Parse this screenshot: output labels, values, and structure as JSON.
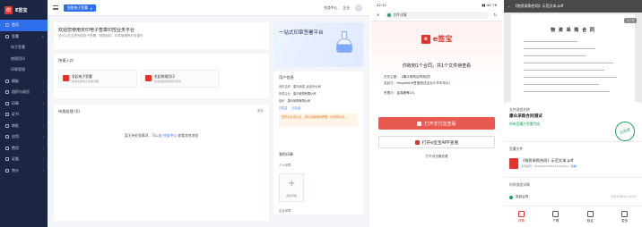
{
  "panel1": {
    "brand": "E签宝",
    "nav": [
      {
        "label": "首页",
        "active": true,
        "arrow": ""
      },
      {
        "label": "签署",
        "active": false,
        "arrow": "∨"
      },
      {
        "label": "电子签署",
        "active": false,
        "sub": true,
        "arrow": ""
      },
      {
        "label": "物理用印",
        "active": false,
        "sub": true,
        "arrow": ""
      },
      {
        "label": "印章管理",
        "active": false,
        "sub": true,
        "arrow": ""
      },
      {
        "label": "模板",
        "active": false,
        "arrow": "›"
      },
      {
        "label": "组织与成员",
        "active": false,
        "arrow": "›"
      },
      {
        "label": "印章",
        "active": false,
        "arrow": "›"
      },
      {
        "label": "证书",
        "active": false,
        "arrow": "›"
      },
      {
        "label": "审批",
        "active": false,
        "arrow": "›"
      },
      {
        "label": "应用",
        "active": false,
        "arrow": "›"
      },
      {
        "label": "费用",
        "active": false,
        "arrow": "›"
      },
      {
        "label": "证据",
        "active": false,
        "arrow": "›"
      },
      {
        "label": "统计",
        "active": false,
        "arrow": "›"
      }
    ],
    "platform_select": "智能电子签署",
    "top_right": {
      "item1": "任务中心",
      "item2": "企业"
    },
    "banner": {
      "text": "欢迎您使用天印电子签章印控业务平台",
      "sub": "您可以在这里完成电子签署、物理用印、印章管理等业务操作"
    },
    "quick": {
      "title": "快速入口",
      "items": [
        {
          "label": "发起电子签署",
          "sub": "快速发起电子签署流程"
        },
        {
          "label": "发起物理用印",
          "sub": "快速发起物理用印申请"
        }
      ]
    },
    "todo": {
      "title": "待我处理",
      "count": "(0)",
      "more": "更多",
      "empty_prefix": "暂无待处理事项，可以去",
      "empty_link": "任务中心",
      "empty_suffix": "查看其他流程"
    },
    "promo": {
      "title": "一站式印章签署平台"
    },
    "user": {
      "title": "用户信息",
      "rows": [
        {
          "k": "我的名称：",
          "v": "康众测试, 北京分公司"
        },
        {
          "k": "所属企业：",
          "v": "康众采购有限公司"
        },
        {
          "k": "组织：",
          "v": "康众采购有限公司"
        }
      ],
      "tags": [
        "已实名",
        "已认证"
      ],
      "warn": "您的企业未认证，部分功能使用受限，请尽快认证。",
      "seal_title": "我的印章",
      "personal_seal": "个人印章",
      "add_seal": "添加印章",
      "org_seal": "企业印章"
    }
  },
  "panel2": {
    "status_time": "22:12",
    "status_icons": "▮▮ 4G 78",
    "url_title": "文件详情",
    "brand": "e签宝",
    "message": "你收到1个合同，共1个文件待查看",
    "info": [
      {
        "k": "任务主题：",
        "v": "《康众采购合同测试》"
      },
      {
        "k": "发起方：",
        "v": "esignest(e签宝测试企业3-华中东片)"
      },
      {
        "k": "签署方：",
        "v": "孟笑峰等2人"
      }
    ],
    "btn_primary": "打开支付宝查看",
    "btn_secondary": "打开e签宝APP查看",
    "browser_link": "打开浏览器查看"
  },
  "panel3": {
    "header_title": "《物资采购合同》示范文本.pdf",
    "page_badge": "1 / 5",
    "doc_title": "物 资 采 购 合 同",
    "sheet": {
      "label_name": "文件流程名称",
      "name": "康众采购合同测试",
      "status": "所有签署方签署完成",
      "stamp": "已完成",
      "label_files": "签署文件",
      "file_name": "《物资采购合同》示范文本.pdf",
      "file_meta": "合同编号：ESIGN202306144781914",
      "copy": "复制",
      "label_flow": "时间流程详情",
      "flow_name": "发起合同",
      "flow_time": "2023/06/14 16:27"
    },
    "tabs": [
      "详情",
      "下载",
      "验证",
      "更多"
    ]
  }
}
